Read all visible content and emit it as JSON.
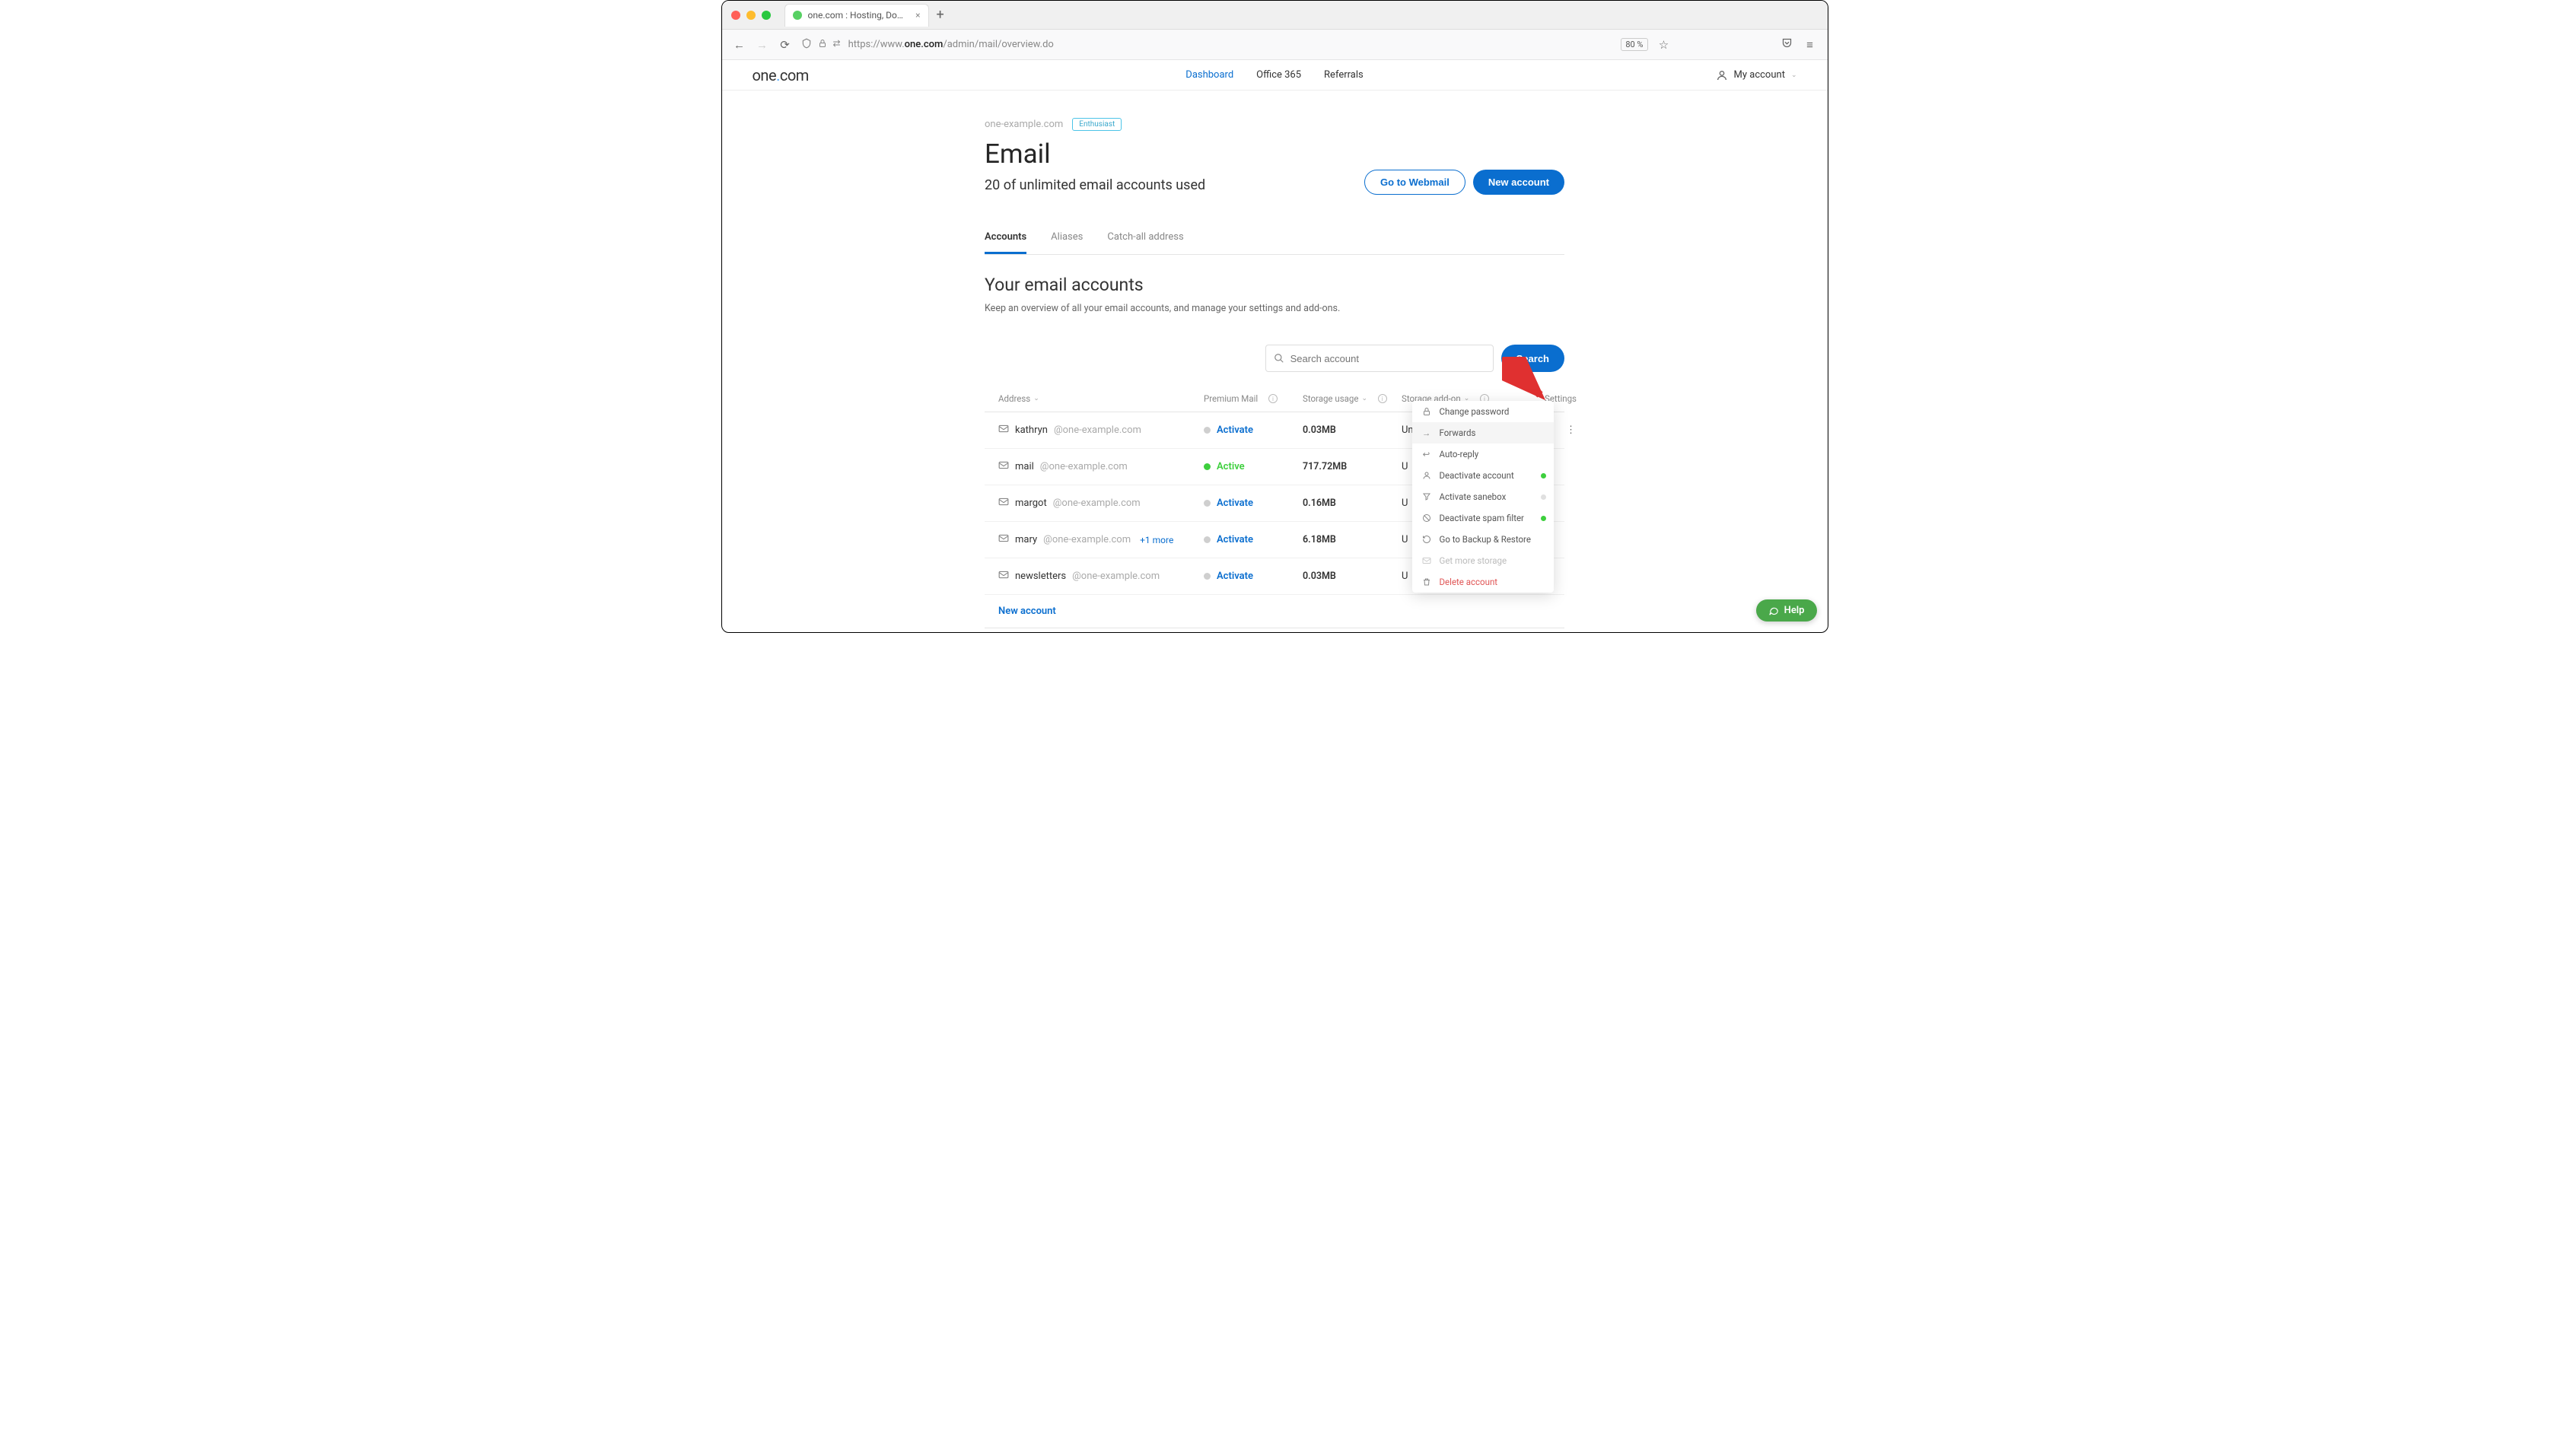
{
  "browser": {
    "tab_title": "one.com : Hosting, Domain, Em…",
    "url_prefix": "https://www.",
    "url_bold": "one.com",
    "url_suffix": "/admin/mail/overview.do",
    "zoom": "80 %"
  },
  "header": {
    "logo_pre": "one",
    "logo_dot": ".",
    "logo_post": "com",
    "nav": {
      "dashboard": "Dashboard",
      "office365": "Office 365",
      "referrals": "Referrals"
    },
    "account": "My account"
  },
  "breadcrumb": {
    "domain": "one-example.com",
    "badge": "Enthusiast"
  },
  "page": {
    "title": "Email",
    "subtitle": "20 of unlimited email accounts used",
    "webmail_btn": "Go to Webmail",
    "new_account_btn": "New account"
  },
  "tabs": {
    "accounts": "Accounts",
    "aliases": "Aliases",
    "catchall": "Catch-all address"
  },
  "section": {
    "title": "Your email accounts",
    "desc": "Keep an overview of all your email accounts, and manage your settings and add-ons."
  },
  "search": {
    "placeholder": "Search account",
    "button": "Search"
  },
  "columns": {
    "address": "Address",
    "premium": "Premium Mail",
    "storage": "Storage usage",
    "addon": "Storage add-on",
    "settings": "Settings"
  },
  "rows": [
    {
      "local": "kathryn",
      "domain": "@one-example.com",
      "extra": "",
      "premium_active": false,
      "premium_label": "Activate",
      "storage": "0.03MB",
      "addon": "Unlimited"
    },
    {
      "local": "mail",
      "domain": "@one-example.com",
      "extra": "",
      "premium_active": true,
      "premium_label": "Active",
      "storage": "717.72MB",
      "addon": "U"
    },
    {
      "local": "margot",
      "domain": "@one-example.com",
      "extra": "",
      "premium_active": false,
      "premium_label": "Activate",
      "storage": "0.16MB",
      "addon": "U"
    },
    {
      "local": "mary",
      "domain": "@one-example.com",
      "extra": "+1 more",
      "premium_active": false,
      "premium_label": "Activate",
      "storage": "6.18MB",
      "addon": "U"
    },
    {
      "local": "newsletters",
      "domain": "@one-example.com",
      "extra": "",
      "premium_active": false,
      "premium_label": "Activate",
      "storage": "0.03MB",
      "addon": "U"
    }
  ],
  "new_account_link": "New account",
  "menu": {
    "change_password": "Change password",
    "forwards": "Forwards",
    "auto_reply": "Auto-reply",
    "deactivate_account": "Deactivate account",
    "activate_sanebox": "Activate sanebox",
    "deactivate_spam": "Deactivate spam filter",
    "backup": "Go to Backup & Restore",
    "get_storage": "Get more storage",
    "delete": "Delete account"
  },
  "help": "Help"
}
